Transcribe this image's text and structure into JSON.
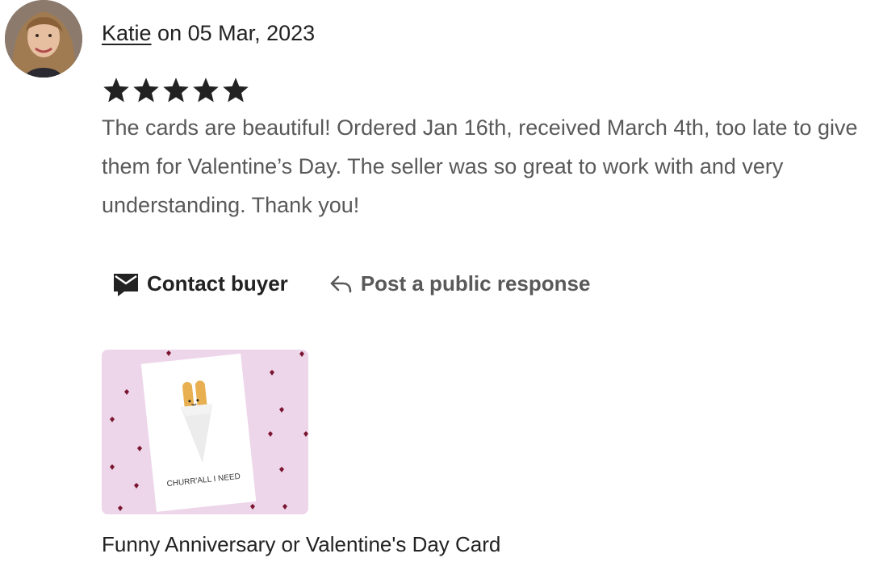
{
  "review": {
    "reviewer_name": "Katie",
    "date_text": " on 05 Mar, 2023",
    "rating": 5,
    "rating_max": 5,
    "text": "The cards are beautiful! Ordered Jan 16th, received March 4th, too late to give them for Valentine’s Day. The seller was so great to work with and very understanding. Thank you!"
  },
  "actions": {
    "contact_label": "Contact buyer",
    "contact_icon": "envelope-icon",
    "respond_label": "Post a public response",
    "respond_icon": "reply-arrow-icon"
  },
  "product": {
    "card_text": "CHURR'ALL I NEED",
    "title": "Funny Anniversary or Valentine's Day Card"
  },
  "colors": {
    "text_primary": "#222222",
    "text_secondary": "#595959",
    "product_bg": "#eed6ea",
    "heart": "#8a1f3c"
  }
}
